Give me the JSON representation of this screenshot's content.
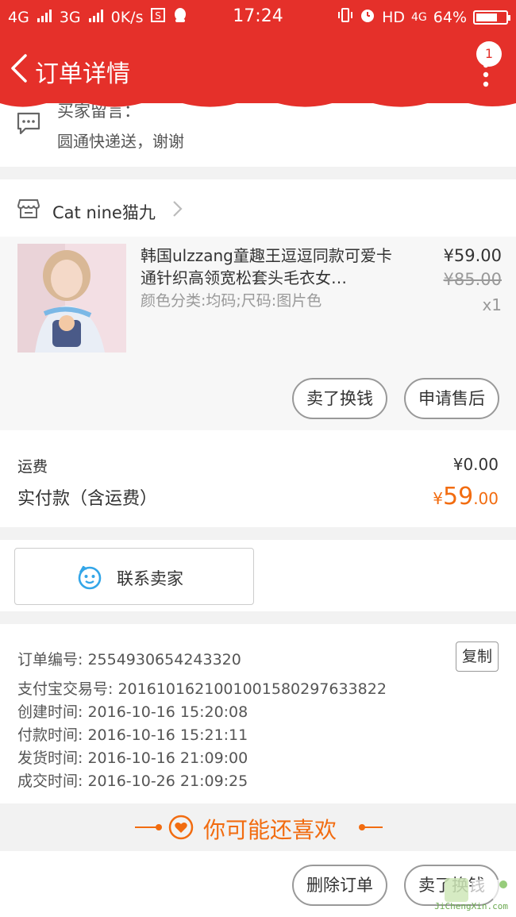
{
  "status_bar": {
    "left": [
      "4G",
      "3G",
      "0K/s"
    ],
    "time": "17:24",
    "right": [
      "HD",
      "4G",
      "64%"
    ]
  },
  "header": {
    "title": "订单详情",
    "notification_count": "1"
  },
  "buyer_message": {
    "label": "买家留言：",
    "text": "圆通快递送，谢谢"
  },
  "shop": {
    "name": "Cat nine猫九"
  },
  "product": {
    "title": "韩国ulzzang童趣王逗逗同款可爱卡通针织高领宽松套头毛衣女…",
    "sku": "颜色分类:均码;尺码:图片色",
    "price_now": "¥59.00",
    "price_old": "¥85.00",
    "qty": "x1",
    "buttons": {
      "sell": "卖了换钱",
      "after_sale": "申请售后"
    }
  },
  "fees": {
    "shipping_label": "运费",
    "shipping_value": "¥0.00",
    "paid_label": "实付款（含运费）",
    "paid_currency": "¥",
    "paid_int": "59",
    "paid_dec": ".00"
  },
  "contact": {
    "label": "联系卖家"
  },
  "order_info": {
    "lines": [
      "订单编号: 2554930654243320",
      "支付宝交易号: 2016101621001001580297633822",
      "创建时间: 2016-10-16 15:20:08",
      "付款时间: 2016-10-16 15:21:11",
      "发货时间: 2016-10-16 21:09:00",
      "成交时间: 2016-10-26 21:09:25"
    ],
    "copy_label": "复制"
  },
  "recommend": {
    "title": "你可能还喜欢"
  },
  "bottom": {
    "delete": "删除订单",
    "sell": "卖了换钱"
  },
  "watermark": "JiChengXin.com",
  "colors": {
    "header_red": "#e5302a",
    "price_orange": "#f26c10"
  }
}
